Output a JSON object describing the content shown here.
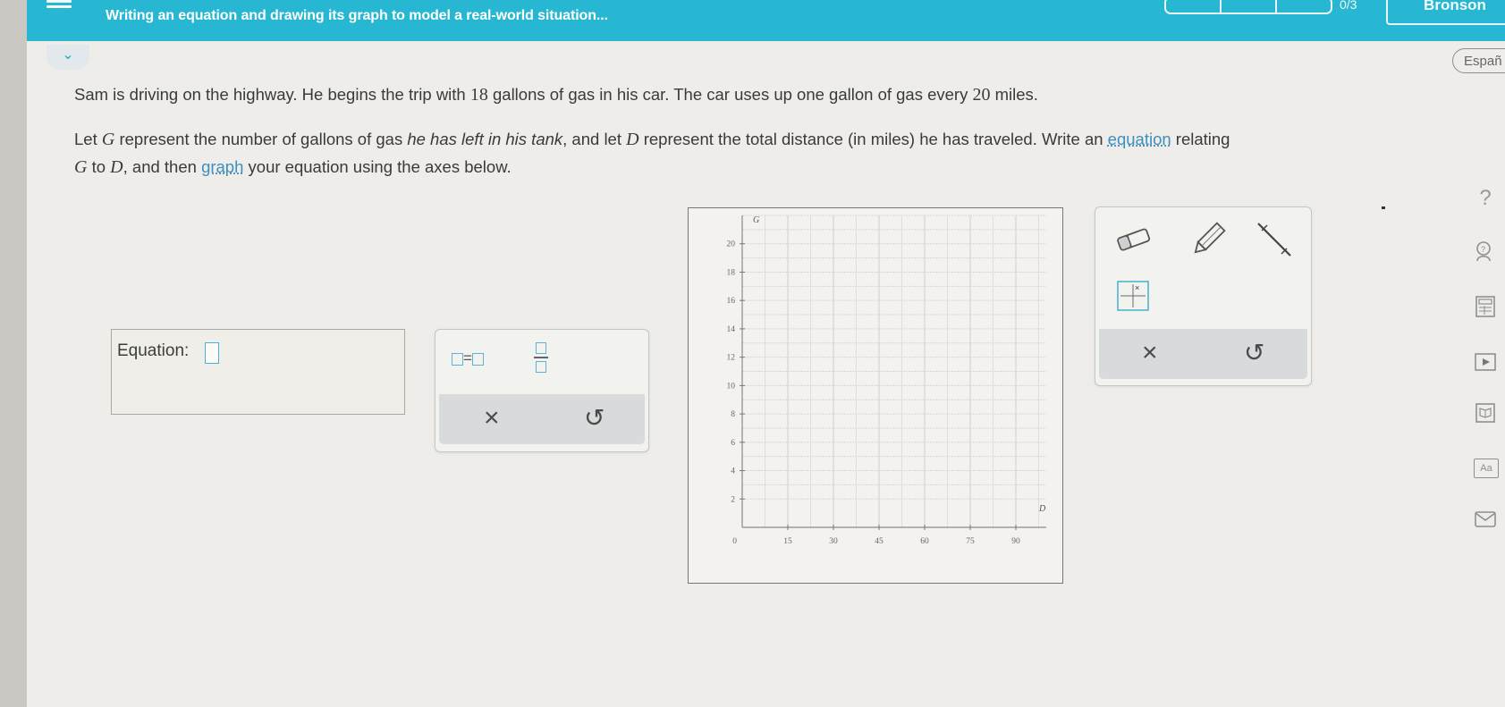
{
  "header": {
    "title": "Writing an equation and drawing its graph to model a real-world situation...",
    "progress_count": "0/3",
    "user_name": "Bronson"
  },
  "language_button": "Españ",
  "question": {
    "line1": {
      "a": "Sam is driving on the highway. He begins the trip with ",
      "gallons": "18",
      "b": " gallons of gas in his car. The car uses up one gallon of gas every ",
      "miles": "20",
      "c": " miles."
    },
    "line2": {
      "a": "Let ",
      "G": "G",
      "b": " represent the number of gallons of gas ",
      "c": "he has left in his tank",
      "d": ", and let ",
      "D": "D",
      "e": " represent the total distance (in miles) he has traveled. Write an ",
      "equation_link": "equation",
      "f": " relating"
    },
    "line3": {
      "G": "G",
      "a": " to ",
      "D": "D",
      "b": ", and then ",
      "graph_link": "graph",
      "c": " your equation using the axes below."
    }
  },
  "equation": {
    "label": "Equation:",
    "value": ""
  },
  "equation_palette": {
    "equals_symbol": "=",
    "clear_symbol": "×",
    "undo_symbol": "↺"
  },
  "graph_tools": {
    "clear_symbol": "×",
    "undo_symbol": "↺"
  },
  "chart_data": {
    "type": "scatter",
    "title": "",
    "xlabel": "D",
    "ylabel": "G",
    "xlim": [
      0,
      100
    ],
    "ylim": [
      0,
      22
    ],
    "x_ticks": [
      15,
      30,
      45,
      60,
      75,
      90
    ],
    "y_ticks": [
      2,
      4,
      6,
      8,
      10,
      12,
      14,
      16,
      18,
      20
    ],
    "origin_label": "0",
    "grid": true,
    "series": []
  },
  "sidebar": {
    "help_symbol": "?",
    "icons": [
      "help-icon",
      "explanation-icon",
      "calculator-icon",
      "video-icon",
      "textbook-icon",
      "glossary-icon",
      "message-icon"
    ],
    "glossary_label": "Aa"
  }
}
